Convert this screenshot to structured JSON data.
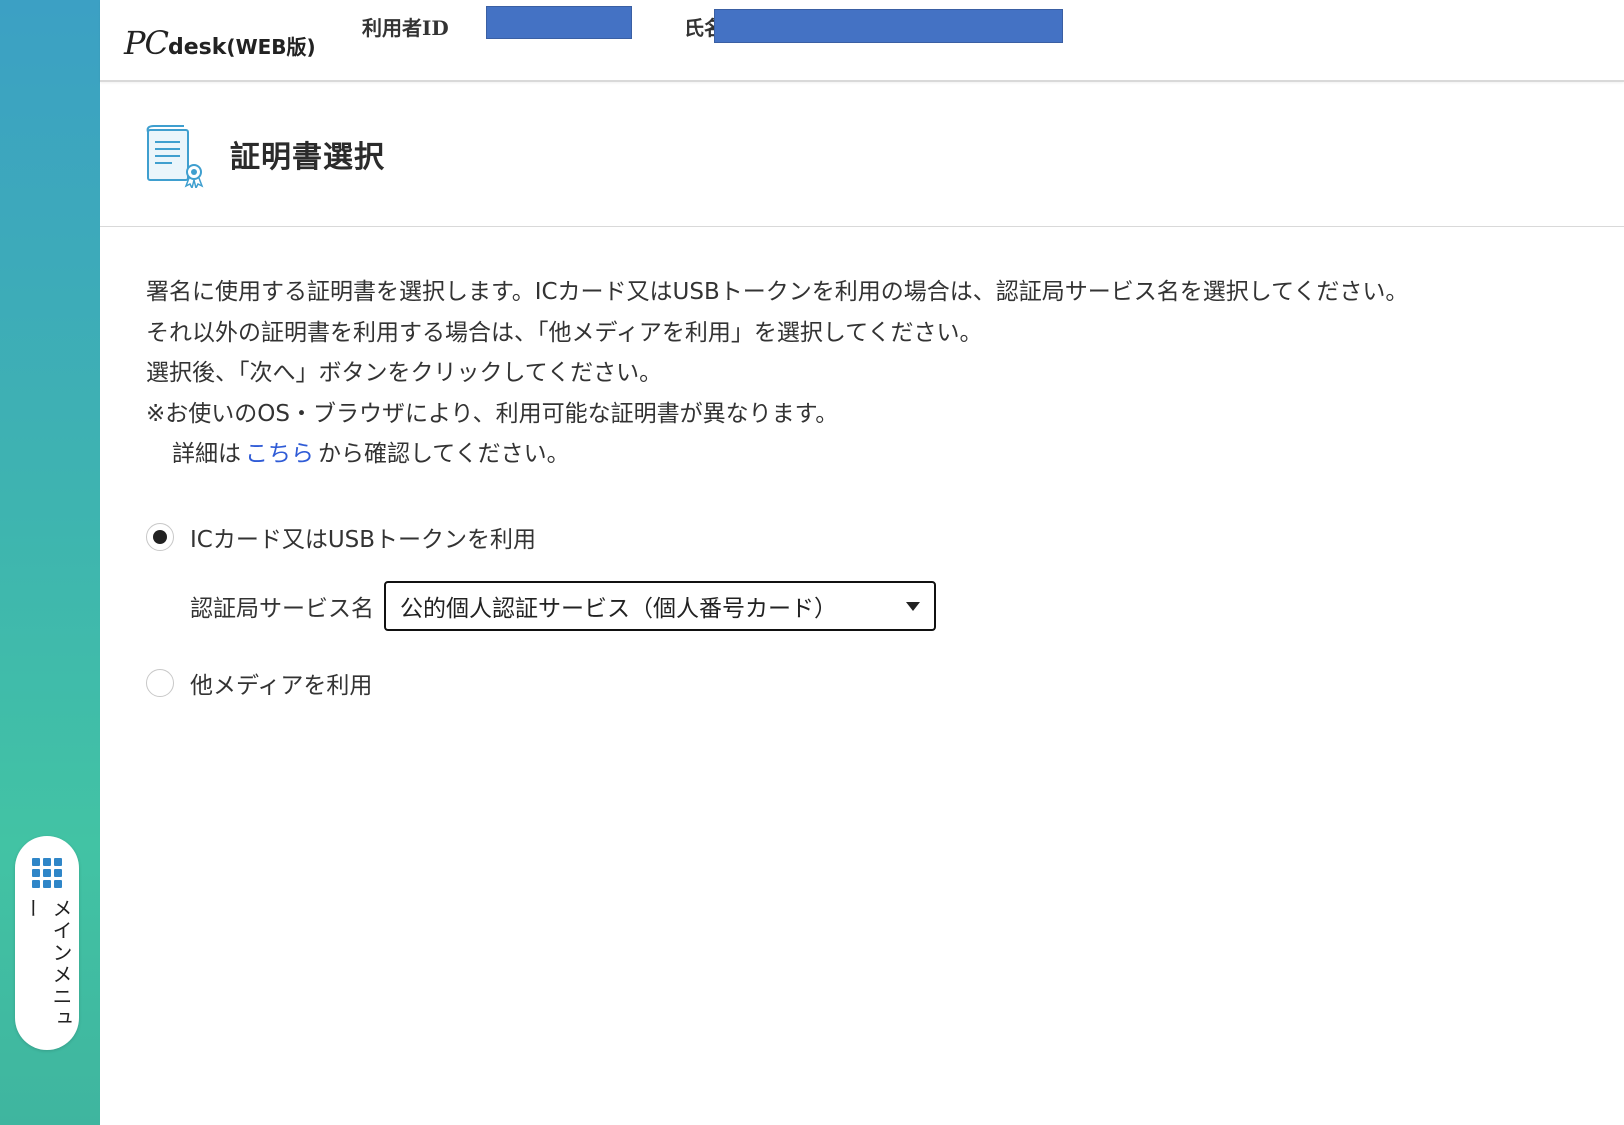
{
  "header": {
    "logo_pc": "PC",
    "logo_desk": "desk",
    "logo_web": "(WEB版)",
    "user_id_label": "利用者ID",
    "name_label": "氏名"
  },
  "sidebar": {
    "menu_label": "メインメニュー",
    "menu_icon": "grid-icon"
  },
  "page": {
    "title": "証明書選択",
    "title_icon": "certificate-icon"
  },
  "description": {
    "line1": "署名に使用する証明書を選択します。ICカード又はUSBトークンを利用の場合は、認証局サービス名を選択してください。",
    "line2": "それ以外の証明書を利用する場合は、「他メディアを利用」を選択してください。",
    "line3": "選択後、「次へ」ボタンをクリックしてください。",
    "line4": "※お使いのOS・ブラウザにより、利用可能な証明書が異なります。",
    "line5_prefix": "詳細は",
    "line5_link": "こちら",
    "line5_suffix": "から確認してください。"
  },
  "options": {
    "ic_card": {
      "label": "ICカード又はUSBトークンを利用",
      "selected": true
    },
    "other_media": {
      "label": "他メディアを利用",
      "selected": false
    }
  },
  "service": {
    "label": "認証局サービス名",
    "selected_value": "公的個人認証サービス（個人番号カード）"
  },
  "colors": {
    "redaction": "#4472c4",
    "link": "#2f5bd6",
    "accent_icon": "#2f86c8"
  }
}
